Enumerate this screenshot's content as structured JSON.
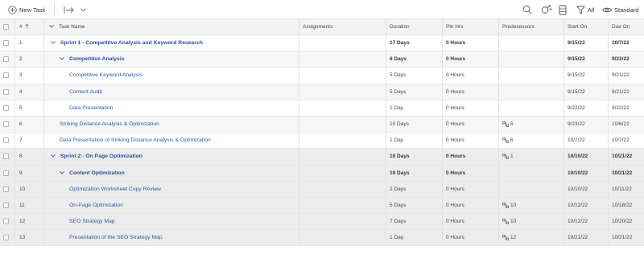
{
  "toolbar": {
    "new_task_label": "New Task",
    "all_label": "All",
    "view_label": "Standard"
  },
  "columns": {
    "num": "#",
    "task": "Task Name",
    "assignments": "Assignments",
    "duration": "Duration",
    "pln_hrs": "Pln Hrs",
    "predecessors": "Predecessors",
    "start": "Start On",
    "due": "Due On"
  },
  "rows": [
    {
      "num": "1",
      "name": "Sprint 1 - Competitive Analysis and Keyword Research",
      "duration": "17 Days",
      "hrs": "0 Hours",
      "pred": "",
      "start": "9/15/22",
      "due": "10/7/22",
      "level": 0,
      "parent": true,
      "bold": true
    },
    {
      "num": "2",
      "name": "Competitive Analysis",
      "duration": "6 Days",
      "hrs": "0 Hours",
      "pred": "",
      "start": "9/15/22",
      "due": "9/22/22",
      "level": 1,
      "parent": true,
      "bold": true
    },
    {
      "num": "3",
      "name": "Competitive Keyword Analysis",
      "duration": "5 Days",
      "hrs": "0 Hours",
      "pred": "",
      "start": "9/15/22",
      "due": "9/21/22",
      "level": 2,
      "parent": false,
      "bold": false
    },
    {
      "num": "4",
      "name": "Content Audit",
      "duration": "5 Days",
      "hrs": "0 Hours",
      "pred": "",
      "start": "9/15/22",
      "due": "9/21/22",
      "level": 2,
      "parent": false,
      "bold": false
    },
    {
      "num": "5",
      "name": "Data Presentation",
      "duration": "1 Day",
      "hrs": "0 Hours",
      "pred": "",
      "start": "9/22/22",
      "due": "9/22/22",
      "level": 2,
      "parent": false,
      "bold": false
    },
    {
      "num": "6",
      "name": "Striking Distance Analysis & Optimization",
      "duration": "10 Days",
      "hrs": "0 Hours",
      "pred": "5",
      "start": "9/23/22",
      "due": "10/6/22",
      "level": 1,
      "parent": false,
      "bold": false
    },
    {
      "num": "7",
      "name": "Data Presentation of Striking Distance Analysis & Optimization",
      "duration": "1 Day",
      "hrs": "0 Hours",
      "pred": "6",
      "start": "10/7/22",
      "due": "10/7/22",
      "level": 1,
      "parent": false,
      "bold": false
    },
    {
      "num": "8",
      "name": "Sprint 2 - On Page Optimization",
      "duration": "10 Days",
      "hrs": "0 Hours",
      "pred": "1",
      "start": "10/10/22",
      "due": "10/21/22",
      "level": 0,
      "parent": true,
      "bold": true
    },
    {
      "num": "9",
      "name": "Content Optimization",
      "duration": "10 Days",
      "hrs": "0 Hours",
      "pred": "",
      "start": "10/10/22",
      "due": "10/21/22",
      "level": 1,
      "parent": true,
      "bold": true
    },
    {
      "num": "10",
      "name": "Optimization Worksheet Copy Review",
      "duration": "2 Days",
      "hrs": "0 Hours",
      "pred": "",
      "start": "10/10/22",
      "due": "10/11/22",
      "level": 2,
      "parent": false,
      "bold": false
    },
    {
      "num": "11",
      "name": "On-Page Optimization",
      "duration": "5 Days",
      "hrs": "0 Hours",
      "pred": "10",
      "start": "10/12/22",
      "due": "10/18/22",
      "level": 2,
      "parent": false,
      "bold": false
    },
    {
      "num": "12",
      "name": "SEO Strategy Map",
      "duration": "7 Days",
      "hrs": "0 Hours",
      "pred": "10",
      "start": "10/12/22",
      "due": "10/20/22",
      "level": 2,
      "parent": false,
      "bold": false
    },
    {
      "num": "13",
      "name": "Presentation of the SEO Strategy Map",
      "duration": "1 Day",
      "hrs": "0 Hours",
      "pred": "12",
      "start": "10/21/22",
      "due": "10/21/22",
      "level": 2,
      "parent": false,
      "bold": false
    }
  ]
}
